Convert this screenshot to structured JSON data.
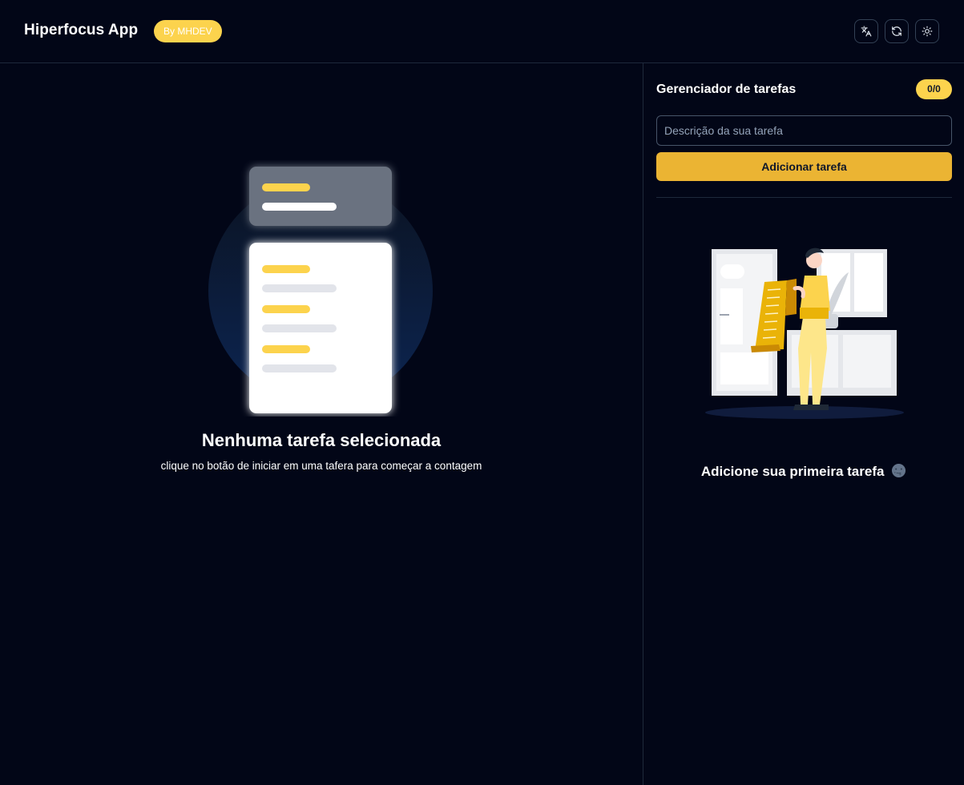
{
  "header": {
    "app_title": "Hiperfocus App",
    "author_badge": "By MHDEV",
    "buttons": {
      "translate_icon": "translate-icon",
      "refresh_icon": "refresh-icon",
      "theme_icon": "sun-icon"
    }
  },
  "main": {
    "empty_title": "Nenhuma tarefa selecionada",
    "empty_subtitle": "clique no botão de iniciar em uma tafera para começar a contagem"
  },
  "sidebar": {
    "title": "Gerenciador de tarefas",
    "counter": "0/0",
    "input_placeholder": "Descrição da sua tarefa",
    "input_value": "",
    "add_button": "Adicionar tarefa",
    "empty_message": "Adicione sua primeira tarefa",
    "empty_emoji": "moon-face-icon"
  },
  "colors": {
    "background": "#020617",
    "accent": "#fcd34d",
    "button": "#ebb433",
    "border": "#1e293b"
  }
}
